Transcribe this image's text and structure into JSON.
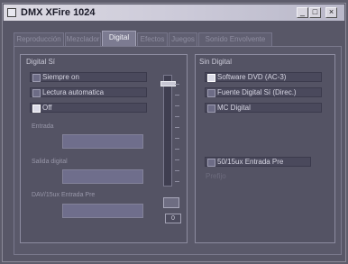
{
  "window": {
    "title": "DMX XFire 1024"
  },
  "titlebar_buttons": {
    "minimize": "_",
    "maximize": "□",
    "close": "×"
  },
  "tabs": [
    {
      "label": "Reproducción"
    },
    {
      "label": "Mezclador"
    },
    {
      "label": "Digital",
      "active": true
    },
    {
      "label": "Efectos"
    },
    {
      "label": "Juegos"
    },
    {
      "label": "Sonido Envolvente"
    }
  ],
  "digital_si": {
    "title": "Digital Sí",
    "options": [
      {
        "label": "Siempre on",
        "checked": false
      },
      {
        "label": "Lectura automatica",
        "checked": false
      },
      {
        "label": "Off",
        "checked": true
      }
    ],
    "sub_fields": [
      {
        "label": "Entrada"
      },
      {
        "label": "Salida digital"
      },
      {
        "label": "DAV/15ux Entrada Pre"
      }
    ],
    "small_box": "0"
  },
  "sin_digital": {
    "title": "Sin Digital",
    "options": [
      {
        "label": "Software DVD (AC-3)",
        "checked": true
      },
      {
        "label": "Fuente Digital Sí (Direc.)",
        "checked": false
      },
      {
        "label": "MC Digital",
        "checked": false
      }
    ],
    "extra_options": [
      {
        "label": "50/15ux Entrada Pre",
        "checked": false
      },
      {
        "label": "Prefijo",
        "checked": false
      }
    ]
  },
  "slider": {
    "level": 0.05
  }
}
